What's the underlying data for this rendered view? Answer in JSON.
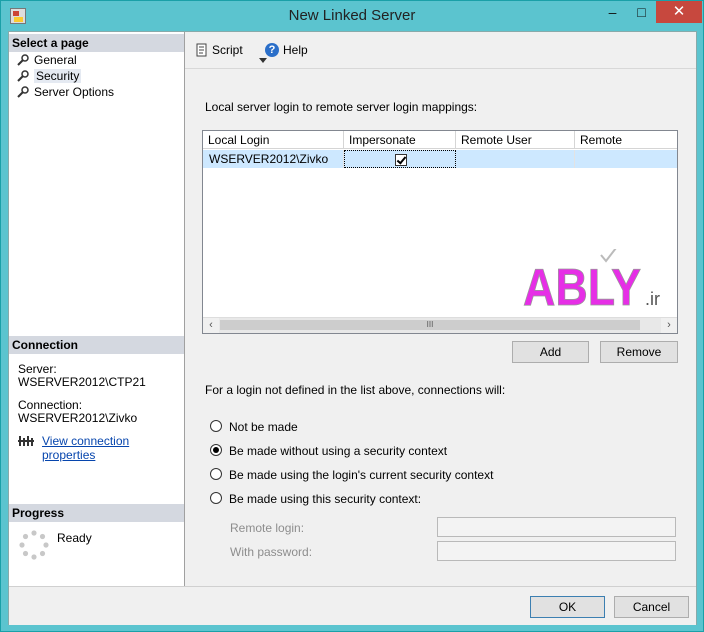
{
  "window": {
    "title": "New Linked Server",
    "minimize_glyph": "–",
    "maximize_glyph": "□",
    "close_glyph": "✕"
  },
  "left": {
    "select_page_header": "Select a page",
    "pages": [
      "General",
      "Security",
      "Server Options"
    ],
    "selected_page": "Security",
    "connection_header": "Connection",
    "server_label": "Server:",
    "server_value": "WSERVER2012\\CTP21",
    "connection_label": "Connection:",
    "connection_value": "WSERVER2012\\Zivko",
    "view_connection_link": "View connection properties",
    "progress_header": "Progress",
    "progress_status": "Ready"
  },
  "toolbar": {
    "script_label": "Script",
    "help_label": "Help"
  },
  "mappings": {
    "label": "Local server login to remote server login mappings:",
    "columns": [
      "Local Login",
      "Impersonate",
      "Remote User",
      "Remote Password"
    ],
    "rows": [
      {
        "local_login": "WSERVER2012\\Zivko",
        "impersonate": true,
        "remote_user": "",
        "remote_password": ""
      }
    ],
    "scroll_thumb_glyph": "III",
    "add_label": "Add",
    "remove_label": "Remove"
  },
  "watermark": {
    "text": "ABLY",
    "suffix": ".ir",
    "color": "#e62ee6"
  },
  "security": {
    "label": "For a login not defined in the list above, connections will:",
    "options": [
      {
        "label": "Not be made",
        "selected": false
      },
      {
        "label": "Be made without using a security context",
        "selected": true
      },
      {
        "label": "Be made using the login's current security context",
        "selected": false
      },
      {
        "label": "Be made using this security context:",
        "selected": false
      }
    ],
    "remote_login_label": "Remote login:",
    "password_label": "With password:",
    "remote_login_value": "",
    "password_value": ""
  },
  "footer": {
    "ok_label": "OK",
    "cancel_label": "Cancel"
  },
  "colors": {
    "titlebar": "#5bc4cf",
    "selection": "#cde8ff",
    "link": "#0645ad",
    "close": "#c7483e"
  }
}
